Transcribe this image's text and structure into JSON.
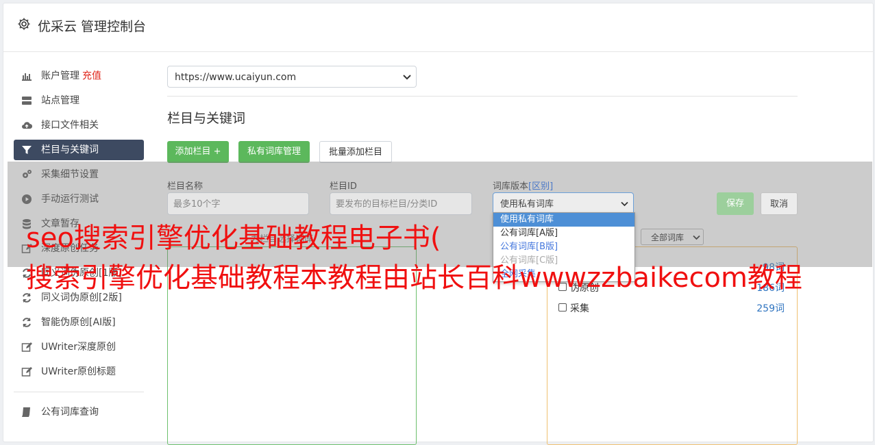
{
  "header": {
    "title": "优采云 管理控制台",
    "icon": "gear-icon"
  },
  "sidebar": {
    "items": [
      {
        "label": "账户管理",
        "tag": "充值",
        "icon": "bar-chart-icon"
      },
      {
        "label": "站点管理",
        "icon": "server-icon"
      },
      {
        "label": "接口文件相关",
        "icon": "cloud-upload-icon"
      },
      {
        "label": "栏目与关键词",
        "icon": "filter-icon",
        "active": true
      },
      {
        "label": "采集细节设置",
        "icon": "cogs-icon"
      },
      {
        "label": "手动运行测试",
        "icon": "play-circle-icon"
      },
      {
        "label": "文章暂存",
        "icon": "database-icon"
      },
      {
        "label": "深度原创任务",
        "icon": "edit-icon"
      },
      {
        "label": "同义词伪原创[1版]",
        "icon": "refresh-icon"
      },
      {
        "label": "同义词伪原创[2版]",
        "icon": "refresh-icon"
      },
      {
        "label": "智能伪原创[AI版]",
        "icon": "refresh-icon"
      },
      {
        "label": "UWriter深度原创",
        "icon": "edit-icon"
      },
      {
        "label": "UWriter原创标题",
        "icon": "edit-icon"
      }
    ],
    "bottom_items": [
      {
        "label": "公有词库查询",
        "icon": "book-icon"
      }
    ]
  },
  "main": {
    "site_select": "https://www.ucaiyun.com",
    "section_title": "栏目与关键词",
    "buttons": {
      "add_column": "添加栏目 +",
      "private_lib": "私有词库管理",
      "batch_add": "批量添加栏目"
    },
    "form": {
      "name_label": "栏目名称",
      "name_placeholder": "最多10个字",
      "id_label": "栏目ID",
      "id_placeholder": "要发布的目标栏目/分类ID",
      "version_label": "词库版本",
      "version_link": "[区别]",
      "version_value": "使用私有词库",
      "save": "保存",
      "cancel": "取消"
    },
    "dropdown_options": [
      "使用私有词库",
      "公有词库[A版]",
      "公有词库[B版]",
      "公有词库[C版]",
      "全网采集"
    ],
    "list_hint": "为栏目选择词库",
    "lib_filter": "全部词库",
    "libraries": [
      {
        "name": "",
        "count": "98词"
      },
      {
        "name": "伪原创",
        "count": "186词"
      },
      {
        "name": "采集",
        "count": "259词"
      }
    ]
  },
  "watermark": {
    "line1": "seo搜索引擎优化基础教程电子书(",
    "line2": "搜索引擎优化基础教程本教程由站长百科wwwzzbaikecom教程"
  },
  "colors": {
    "active_nav": "#3d4a61",
    "green_button": "#5cb85c",
    "accent_red": "#e0261b",
    "watermark": "#f01010"
  }
}
